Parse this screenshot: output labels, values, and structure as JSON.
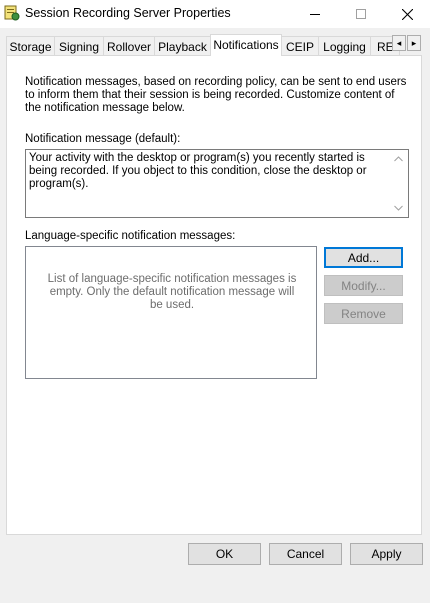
{
  "window": {
    "title": "Session Recording Server Properties"
  },
  "tabs": [
    {
      "label": "Storage"
    },
    {
      "label": "Signing"
    },
    {
      "label": "Rollover"
    },
    {
      "label": "Playback"
    },
    {
      "label": "Notifications",
      "active": true
    },
    {
      "label": "CEIP"
    },
    {
      "label": "Logging"
    },
    {
      "label": "RE"
    }
  ],
  "tab_scroll": {
    "left": "◂",
    "right": "▸"
  },
  "notifications": {
    "description": "Notification messages, based on recording policy, can be sent to end users to inform them that their session is being recorded. Customize content of the notification message below.",
    "default_label": "Notification message (default):",
    "default_message": "Your activity with the desktop or program(s) you recently started is being recorded. If you object to this condition, close the desktop or program(s).",
    "language_label": "Language-specific notification messages:",
    "list_empty_text": "List of language-specific notification messages is empty. Only the default notification message will be used.",
    "add_button": "Add...",
    "modify_button": "Modify...",
    "remove_button": "Remove"
  },
  "footer": {
    "ok_button": "OK",
    "cancel_button": "Cancel",
    "apply_button": "Apply"
  },
  "colors": {
    "accent": "#0078d7",
    "window_bg": "#f0f0f0",
    "panel_bg": "#ffffff"
  }
}
